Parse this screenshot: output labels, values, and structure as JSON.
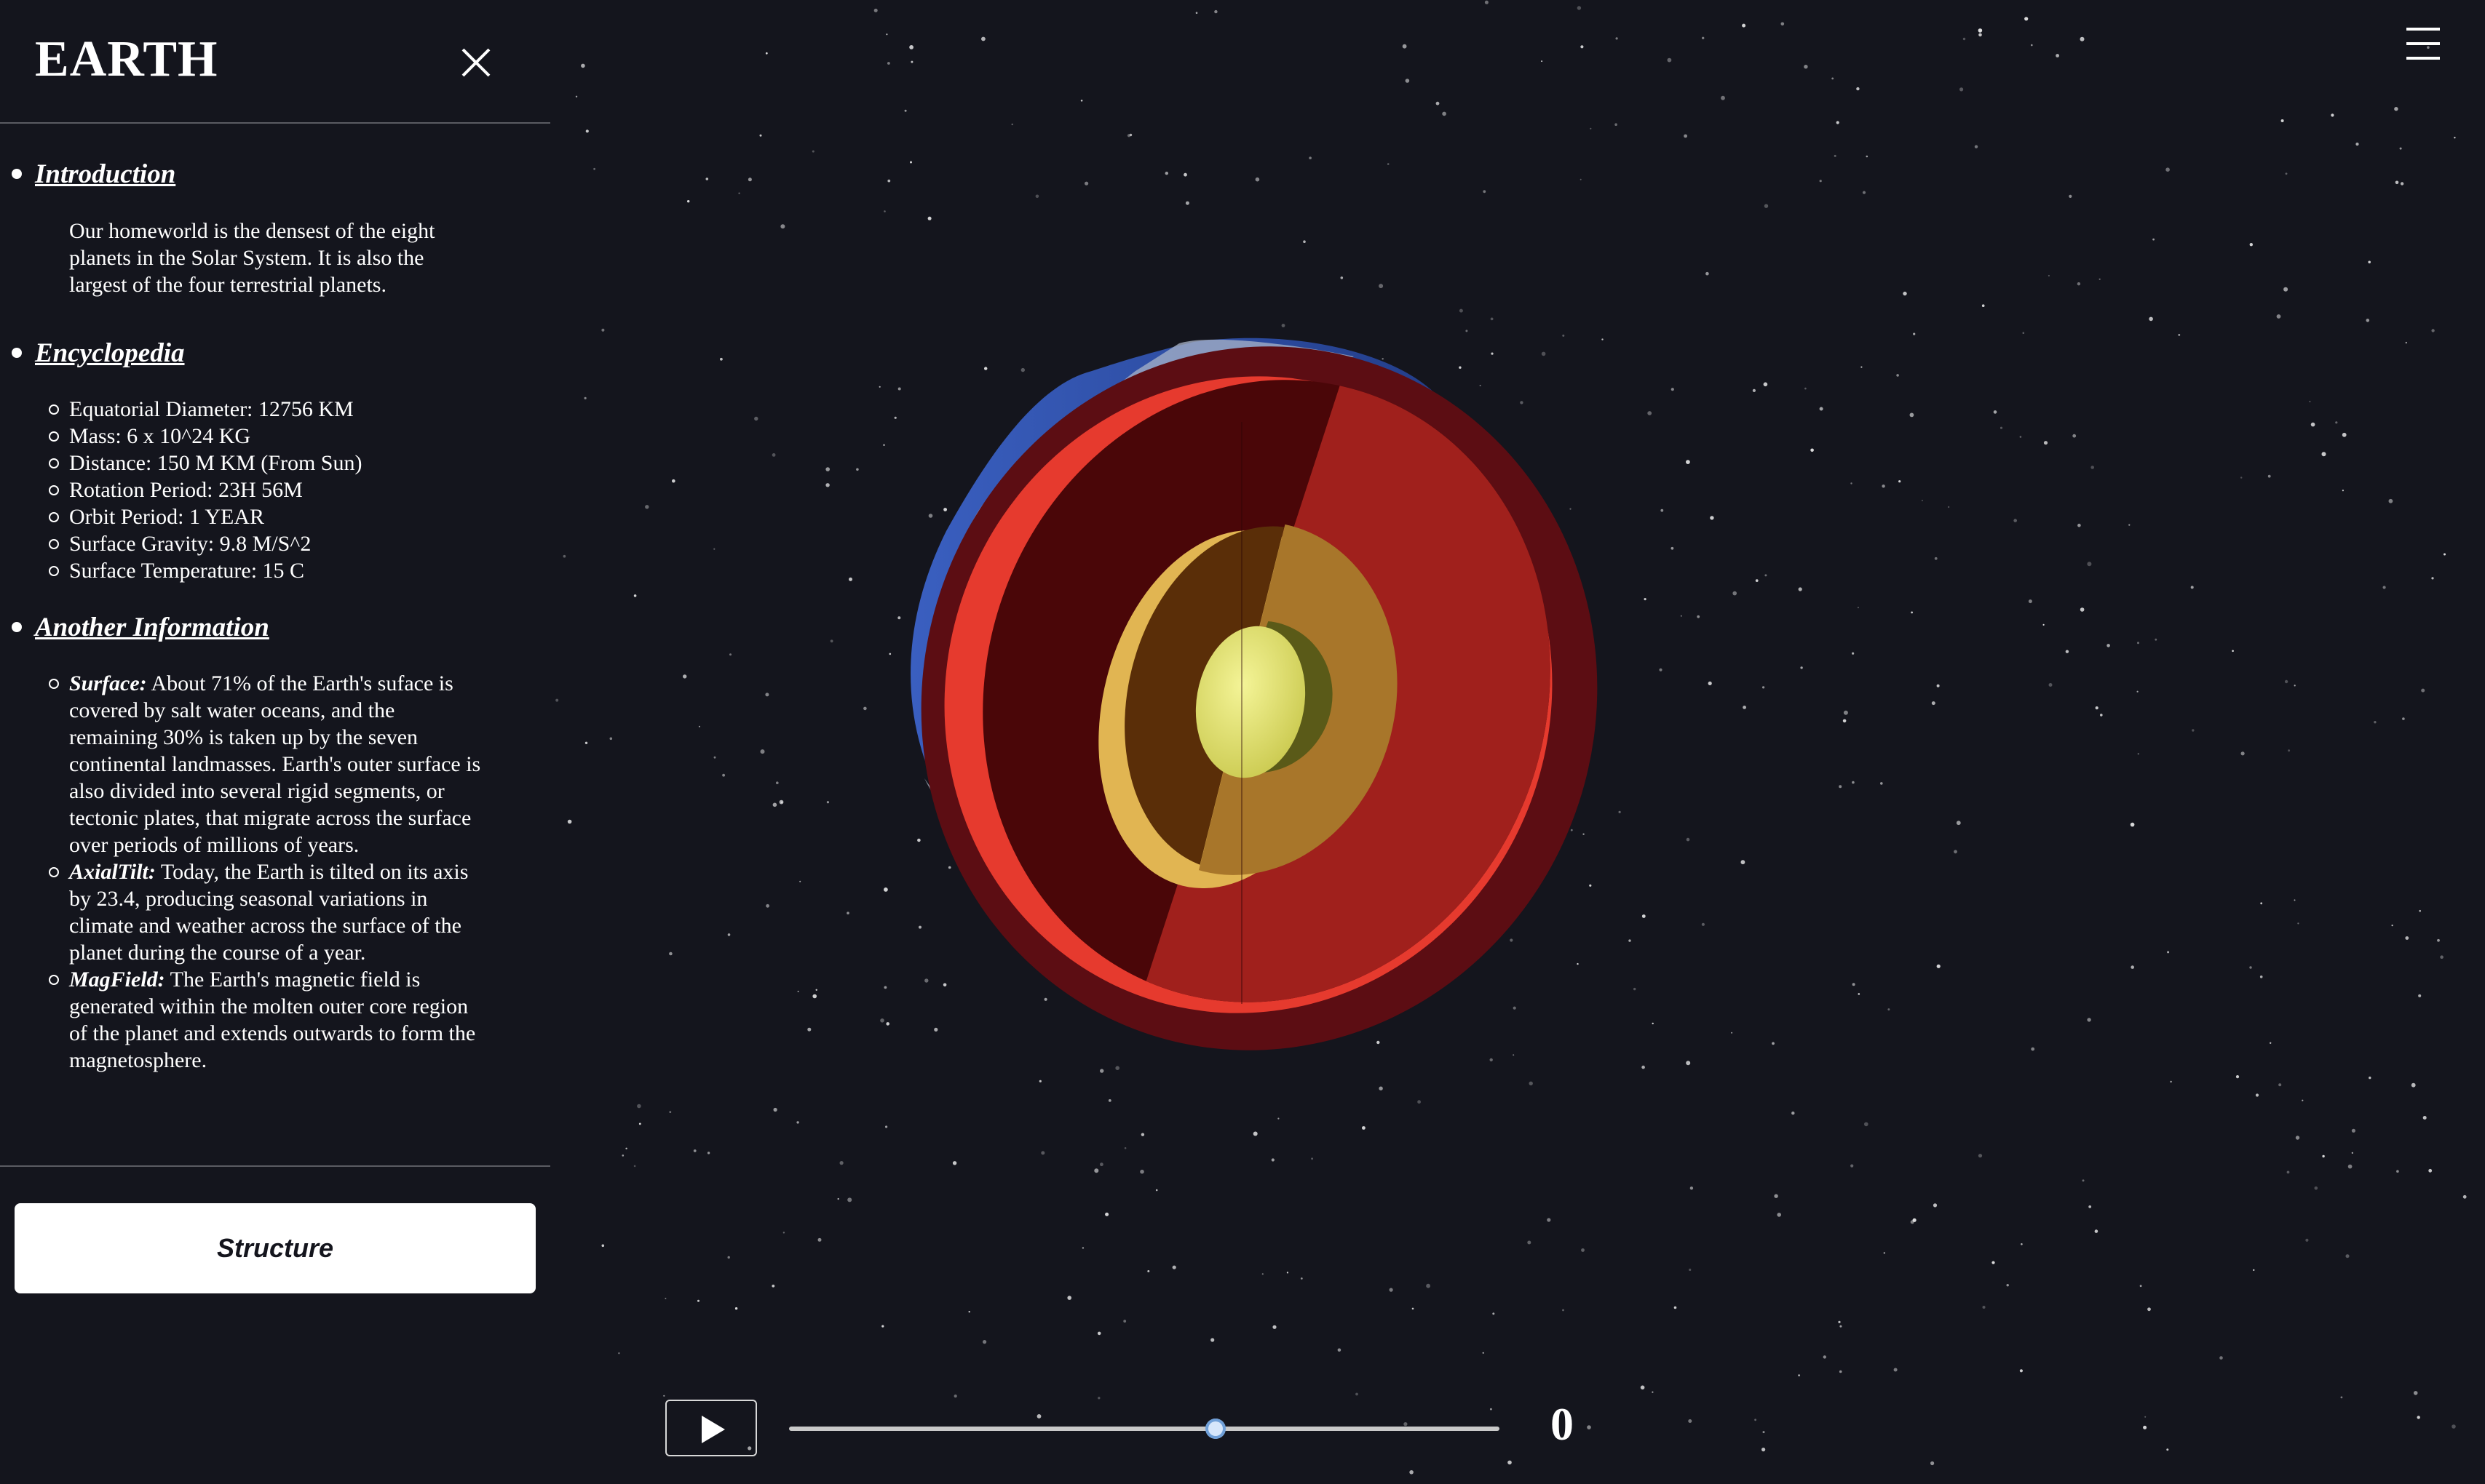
{
  "app": {
    "title": "EARTH"
  },
  "sidebar": {
    "close_icon": "close-icon",
    "introduction": {
      "heading": "Introduction",
      "text": "Our homeworld is the densest of the eight planets in the Solar System. It is also the largest of the four terrestrial planets."
    },
    "encyclopedia": {
      "heading": "Encyclopedia",
      "items": [
        "Equatorial Diameter: 12756 KM",
        "Mass: 6 x 10^24 KG",
        "Distance: 150 M KM (From Sun)",
        "Rotation Period: 23H 56M",
        "Orbit Period: 1 YEAR",
        "Surface Gravity: 9.8 M/S^2",
        "Surface Temperature: 15 C"
      ]
    },
    "another_information": {
      "heading": "Another Information",
      "items": [
        {
          "label": "Surface:",
          "text": " About 71% of the Earth's suface is covered by salt water oceans, and the remaining 30% is taken up by the seven continental landmasses. Earth's outer surface is also divided into several rigid segments, or tectonic plates, that migrate across the surface over periods of millions of years."
        },
        {
          "label": "AxialTilt:",
          "text": " Today, the Earth is tilted on its axis by 23.4, producing seasonal variations in climate and weather across the surface of the planet during the course of a year."
        },
        {
          "label": "MagField:",
          "text": " The Earth's magnetic field is generated within the molten outer core region of the planet and extends outwards to form the magnetosphere."
        }
      ]
    },
    "structure_button": "Structure"
  },
  "header": {
    "menu_icon": "hamburger-menu-icon"
  },
  "controls": {
    "play_icon": "play-icon",
    "slider_value": 0.6,
    "frame_counter": "0"
  },
  "colors": {
    "background": "#14151d",
    "crust": "#5c0d13",
    "mantle": "#9f1f1b",
    "outer_core": "#a8762a",
    "inner_core": "#dede6a",
    "ocean": "#2e4fa8"
  }
}
